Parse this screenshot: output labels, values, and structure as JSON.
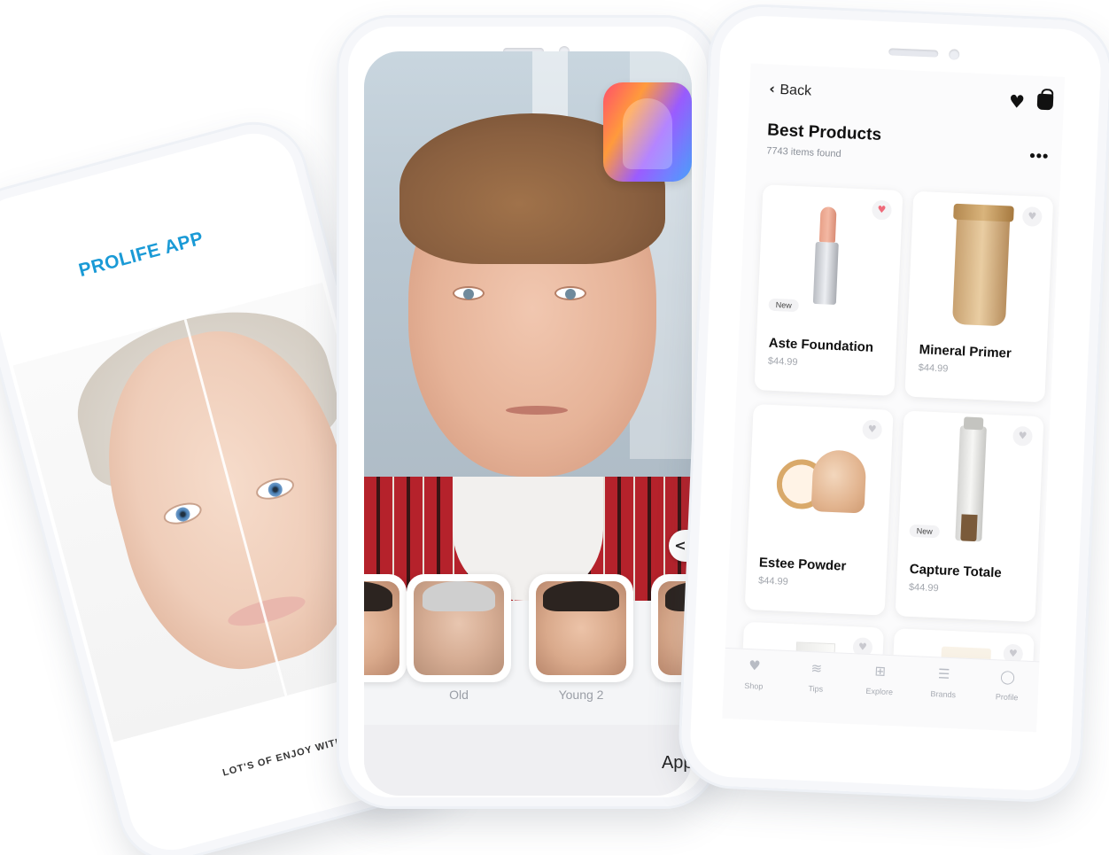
{
  "left_phone": {
    "brand": "PROLIFE APP",
    "tagline": "LOT'S OF ENJOY WITH P"
  },
  "middle_phone": {
    "compare_icon": "<",
    "filters": [
      {
        "label": "Old"
      },
      {
        "label": "Young 2"
      }
    ],
    "apply_label": "Appl"
  },
  "right_phone": {
    "back_label": "Back",
    "title": "Best Products",
    "count": "7743 items found",
    "more": "•••",
    "products": [
      {
        "name": "Aste Foundation",
        "price": "$44.99",
        "badge": "New",
        "favorited": true
      },
      {
        "name": "Mineral Primer",
        "price": "$44.99",
        "badge": "",
        "favorited": false
      },
      {
        "name": "Estee Powder",
        "price": "$44.99",
        "badge": "",
        "favorited": false
      },
      {
        "name": "Capture Totale",
        "price": "$44.99",
        "badge": "New",
        "favorited": false
      }
    ],
    "tabs": [
      {
        "label": "Shop",
        "icon": "heart-icon"
      },
      {
        "label": "Tips",
        "icon": "layers-icon"
      },
      {
        "label": "Explore",
        "icon": "grid-icon"
      },
      {
        "label": "Brands",
        "icon": "list-icon"
      },
      {
        "label": "Profile",
        "icon": "user-icon"
      }
    ]
  },
  "colors": {
    "brand_blue": "#1a9ad6",
    "heart_active": "#ef6a7a"
  }
}
